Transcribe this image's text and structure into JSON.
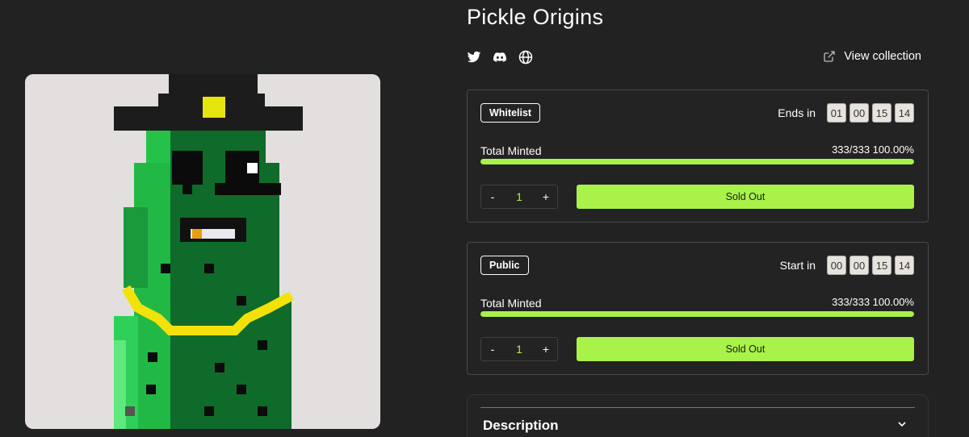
{
  "collection": {
    "title": "Pickle Origins",
    "view_collection_label": "View collection",
    "socials": [
      "twitter-icon",
      "discord-icon",
      "globe-icon"
    ]
  },
  "phases": [
    {
      "badge": "Whitelist",
      "timer_label": "Ends in",
      "timer": [
        "01",
        "00",
        "15",
        "14"
      ],
      "minted_label": "Total Minted",
      "minted_count": "333/333 100.00%",
      "progress": 1.0,
      "quantity": "1",
      "minus": "-",
      "plus": "+",
      "button_label": "Sold Out"
    },
    {
      "badge": "Public",
      "timer_label": "Start in",
      "timer": [
        "00",
        "00",
        "15",
        "14"
      ],
      "minted_label": "Total Minted",
      "minted_count": "333/333 100.00%",
      "progress": 1.0,
      "quantity": "1",
      "minus": "-",
      "plus": "+",
      "button_label": "Sold Out"
    }
  ],
  "description": {
    "title": "Description"
  },
  "colors": {
    "background": "#222222",
    "accent": "#a8f24a",
    "pickle_dark": "#0f6b2a",
    "pickle_light": "#1fbb45",
    "hat": "#1c1c1c",
    "gold": "#f2e20a"
  }
}
